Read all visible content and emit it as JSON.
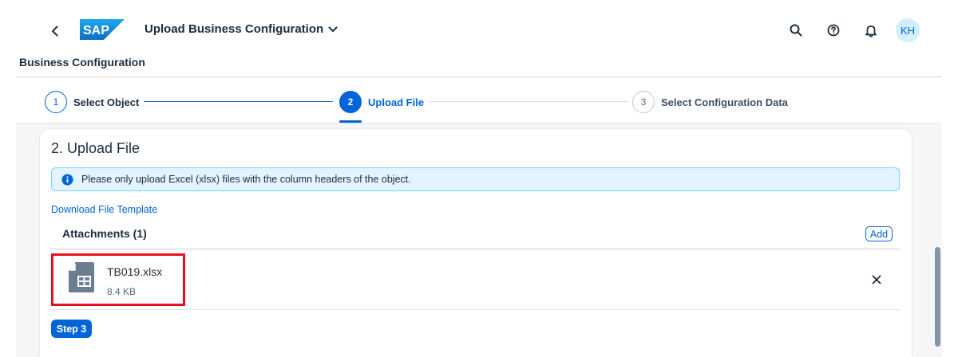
{
  "shell": {
    "app_title": "Upload Business Configuration",
    "logo_text": "SAP",
    "user_initials": "KH",
    "icons": [
      "back-icon",
      "search-icon",
      "help-icon",
      "notification-bell-icon"
    ]
  },
  "page": {
    "header_title": "Business Configuration"
  },
  "wizard": {
    "steps": [
      {
        "number": "1",
        "label": "Select Object",
        "state": "completed"
      },
      {
        "number": "2",
        "label": "Upload File",
        "state": "active"
      },
      {
        "number": "3",
        "label": "Select Configuration Data",
        "state": "upcoming"
      }
    ]
  },
  "section": {
    "title": "2. Upload File",
    "info_message": "Please only upload Excel (xlsx) files with the column headers of the object.",
    "download_link": "Download File Template",
    "attachments_title": "Attachments (1)",
    "add_label": "Add",
    "files": [
      {
        "name": "TB019.xlsx",
        "size": "8.4 KB",
        "icon": "spreadsheet-file-icon"
      }
    ],
    "next_step_label": "Step 3"
  },
  "colors": {
    "accent": "#0064d9",
    "highlight": "#e8101f",
    "info_bg": "#e1f4ff",
    "info_border": "#7bcfff"
  }
}
